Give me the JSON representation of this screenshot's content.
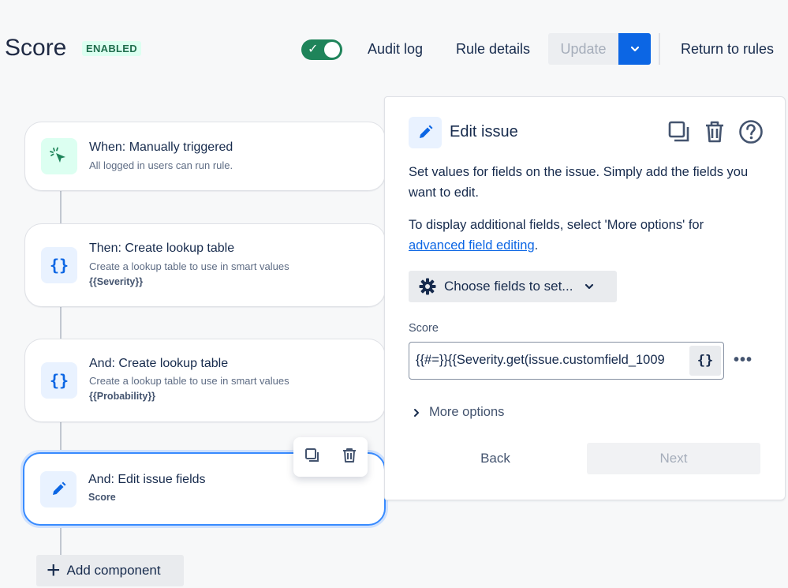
{
  "header": {
    "title": "Score",
    "badge": "ENABLED",
    "toggle_on": true,
    "audit_log": "Audit log",
    "rule_details": "Rule details",
    "update": "Update",
    "return_to_rules": "Return to rules"
  },
  "colors": {
    "accent": "#0c66e4",
    "toggle": "#1f845a",
    "badge_bg": "#dcfff1",
    "selected_border": "#388bff"
  },
  "components": [
    {
      "title": "When: Manually triggered",
      "subtitle": "All logged in users can run rule.",
      "detail": "",
      "icon": "cursor-click-icon"
    },
    {
      "title": "Then: Create lookup table",
      "subtitle": "Create a lookup table to use in smart values",
      "detail": "{{Severity}}",
      "icon": "curly-braces-icon"
    },
    {
      "title": "And: Create lookup table",
      "subtitle": "Create a lookup table to use in smart values",
      "detail": "{{Probability}}",
      "icon": "curly-braces-icon"
    },
    {
      "title": "And: Edit issue fields",
      "subtitle": "",
      "detail": "Score",
      "icon": "pencil-icon"
    }
  ],
  "add_component": "Add component",
  "panel": {
    "title": "Edit issue",
    "desc1": "Set values for fields on the issue. Simply add the fields you want to edit.",
    "desc2_prefix": "To display additional fields, select 'More options' for ",
    "desc2_link": "advanced field editing",
    "desc2_suffix": ".",
    "choose_fields": "Choose fields to set...",
    "score_label": "Score",
    "score_value": "{{#=}}{{Severity.get(issue.customfield_1009",
    "smart_value_btn": "{}",
    "more_options": "More options",
    "back": "Back",
    "next": "Next"
  }
}
